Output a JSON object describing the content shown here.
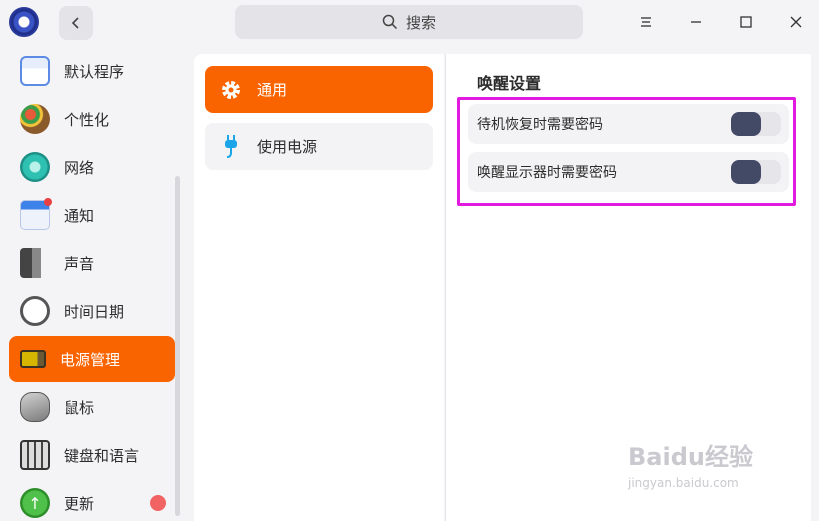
{
  "header": {
    "search_placeholder": "搜索"
  },
  "sidebar": {
    "items": [
      {
        "label": "默认程序",
        "icon": "default-apps-icon"
      },
      {
        "label": "个性化",
        "icon": "personalization-icon"
      },
      {
        "label": "网络",
        "icon": "network-icon"
      },
      {
        "label": "通知",
        "icon": "notification-icon"
      },
      {
        "label": "声音",
        "icon": "sound-icon"
      },
      {
        "label": "时间日期",
        "icon": "clock-icon"
      },
      {
        "label": "电源管理",
        "icon": "battery-icon",
        "active": true
      },
      {
        "label": "鼠标",
        "icon": "mouse-icon"
      },
      {
        "label": "键盘和语言",
        "icon": "keyboard-icon"
      },
      {
        "label": "更新",
        "icon": "update-icon",
        "badge": true
      }
    ]
  },
  "middle": {
    "items": [
      {
        "label": "通用",
        "icon": "gear-icon",
        "active": true
      },
      {
        "label": "使用电源",
        "icon": "plug-icon"
      }
    ]
  },
  "right": {
    "section_title": "唤醒设置",
    "settings": [
      {
        "label": "待机恢复时需要密码",
        "enabled": false
      },
      {
        "label": "唤醒显示器时需要密码",
        "enabled": false
      }
    ]
  },
  "watermark": {
    "text": "Baidu经验",
    "url_text": "jingyan.baidu.com"
  },
  "colors": {
    "accent": "#f96400",
    "highlight_border": "#e21ae0",
    "toggle_knob": "#424a66",
    "badge": "#f26464"
  }
}
